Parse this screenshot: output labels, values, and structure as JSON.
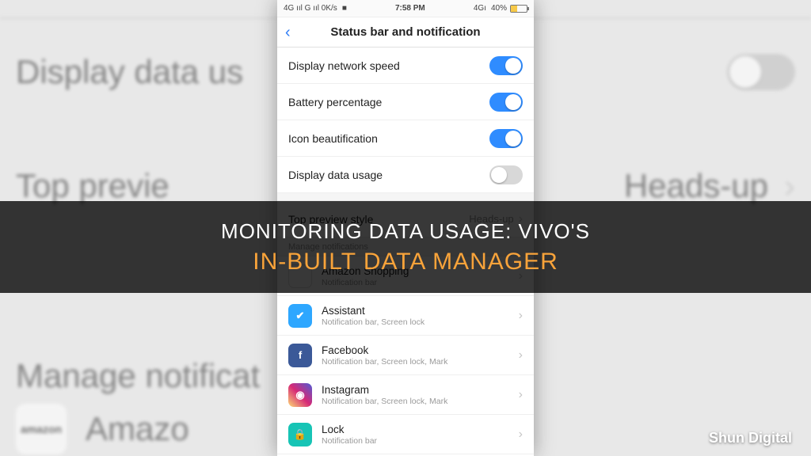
{
  "overlay": {
    "line1": "MONITORING DATA USAGE: VIVO'S",
    "line2": "IN-BUILT DATA MANAGER"
  },
  "watermark": "Shun Digital",
  "bg": {
    "row1": "Display data us",
    "row2_left": "Top previe",
    "row2_right": "Heads-up",
    "row3": "Manage notificat",
    "amazon": "Amazo",
    "amazon_icon_label": "amazon"
  },
  "phone": {
    "status": {
      "left": "4G ııl  G ııl  0K/s",
      "video_icon": "■",
      "time": "7:58 PM",
      "right_net": "4Gı",
      "battery_pct": "40%"
    },
    "header": {
      "back": "‹",
      "title": "Status bar and notification"
    },
    "toggles": [
      {
        "label": "Display network speed",
        "on": true
      },
      {
        "label": "Battery percentage",
        "on": true
      },
      {
        "label": "Icon beautification",
        "on": true
      },
      {
        "label": "Display data usage",
        "on": false
      }
    ],
    "preview": {
      "label": "Top preview style",
      "value": "Heads-up"
    },
    "section": "Manage notifications",
    "apps": [
      {
        "name": "Amazon Shopping",
        "detail": "Notification bar",
        "icon": "amazon"
      },
      {
        "name": "Assistant",
        "detail": "Notification bar, Screen lock",
        "icon": "assist"
      },
      {
        "name": "Facebook",
        "detail": "Notification bar, Screen lock, Mark",
        "icon": "fb"
      },
      {
        "name": "Instagram",
        "detail": "Notification bar, Screen lock, Mark",
        "icon": "ig"
      },
      {
        "name": "Lock",
        "detail": "Notification bar",
        "icon": "lock"
      }
    ],
    "icon_glyph": {
      "amazon": "a",
      "assist": "✔",
      "fb": "f",
      "ig": "◉",
      "lock": "🔒"
    }
  }
}
